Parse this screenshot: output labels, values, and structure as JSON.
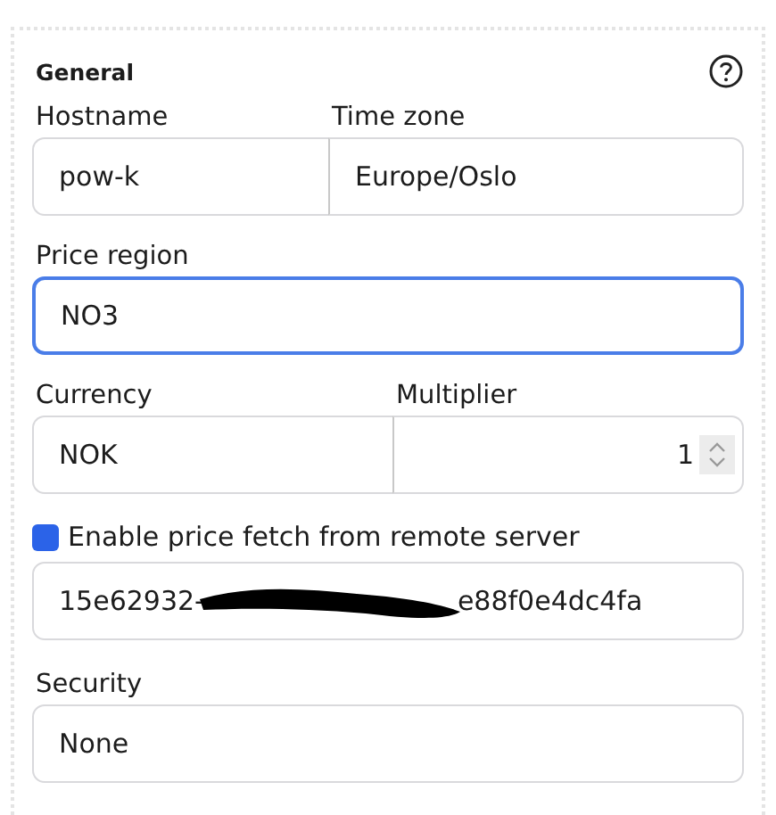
{
  "section": {
    "title": "General",
    "help": true
  },
  "rows": [
    {
      "fields": [
        {
          "label": "Hostname",
          "value": "pow-k",
          "kind": "text",
          "focused": false
        },
        {
          "label": "Time zone",
          "value": "Europe/Oslo",
          "kind": "text",
          "focused": false
        }
      ]
    },
    {
      "fields": [
        {
          "label": "Price region",
          "value": "NO3",
          "kind": "text",
          "focused": true
        }
      ]
    },
    {
      "fields": [
        {
          "label": "Currency",
          "value": "NOK",
          "kind": "text",
          "focused": false
        },
        {
          "label": "Multiplier",
          "value": "1",
          "kind": "number",
          "focused": false
        }
      ]
    }
  ],
  "price_fetch": {
    "label": "Enable price fetch from remote server",
    "checked": true,
    "key_start": "15e62932-",
    "key_end": "e88f0e4dc4fa",
    "redacted": true
  },
  "security": {
    "label": "Security",
    "value": "None",
    "focused": false
  }
}
